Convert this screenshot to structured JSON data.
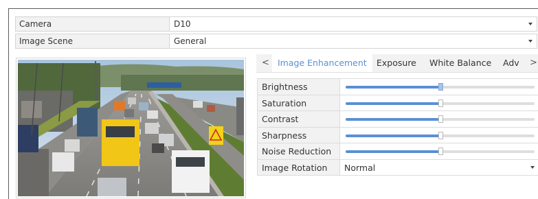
{
  "camera_row": {
    "label": "Camera",
    "value": "D10"
  },
  "scene_row": {
    "label": "Image Scene",
    "value": "General"
  },
  "tabs": {
    "prev_arrow": "<",
    "next_arrow": ">",
    "items": [
      {
        "label": "Image Enhancement",
        "active": true
      },
      {
        "label": "Exposure",
        "active": false
      },
      {
        "label": "White Balance",
        "active": false
      },
      {
        "label": "Adv",
        "active": false
      }
    ]
  },
  "settings": {
    "brightness": {
      "label": "Brightness",
      "level": 0.5
    },
    "saturation": {
      "label": "Saturation",
      "level": 0.5
    },
    "contrast": {
      "label": "Contrast",
      "level": 0.5
    },
    "sharpness": {
      "label": "Sharpness",
      "level": 0.5
    },
    "noise_reduction": {
      "label": "Noise Reduction",
      "level": 0.5
    },
    "image_rotation": {
      "label": "Image Rotation",
      "value": "Normal"
    }
  },
  "colors": {
    "accent": "#5b8fd6",
    "label_bg": "#f2f2f2",
    "border": "#d4d4d4"
  }
}
